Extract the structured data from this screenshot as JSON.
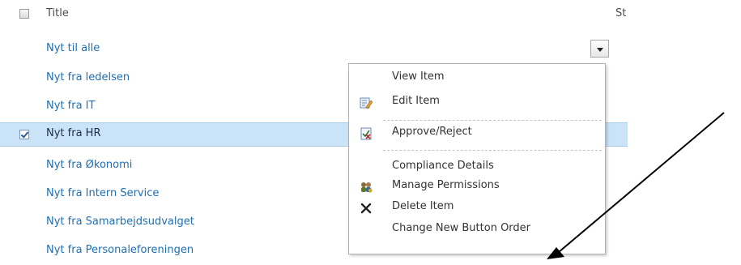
{
  "header": {
    "title_label": "Title",
    "status_col_label": "St"
  },
  "rows": [
    {
      "label": "Nyt til alle",
      "selected": false
    },
    {
      "label": "Nyt fra ledelsen",
      "selected": false
    },
    {
      "label": "Nyt fra IT",
      "selected": false
    },
    {
      "label": "Nyt fra HR",
      "selected": true
    },
    {
      "label": "Nyt fra Økonomi",
      "selected": false
    },
    {
      "label": "Nyt fra Intern Service",
      "selected": false
    },
    {
      "label": "Nyt fra Samarbejdsudvalget",
      "selected": false
    },
    {
      "label": "Nyt fra Personaleforeningen",
      "selected": false
    }
  ],
  "context_menu": {
    "items": [
      {
        "label": "View Item",
        "icon": null
      },
      {
        "label": "Edit Item",
        "icon": "edit-icon"
      },
      {
        "label": "Approve/Reject",
        "icon": "approve-reject-icon"
      },
      {
        "label": "Compliance Details",
        "icon": null
      },
      {
        "label": "Manage Permissions",
        "icon": "permissions-icon"
      },
      {
        "label": "Delete Item",
        "icon": "delete-icon"
      },
      {
        "label": "Change New Button Order",
        "icon": null
      }
    ]
  },
  "colors": {
    "link": "#1e6fb3",
    "selected_row": "#cbe3f7",
    "menu_border": "#b0b0b0"
  }
}
